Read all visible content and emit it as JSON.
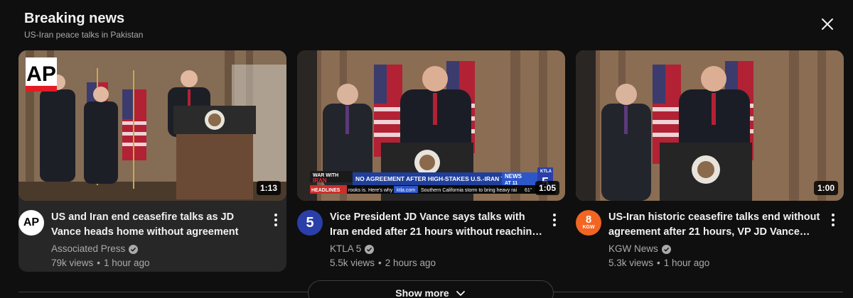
{
  "section": {
    "title": "Breaking news",
    "subtitle": "US-Iran peace talks in Pakistan"
  },
  "videos": [
    {
      "title": "US and Iran end ceasefire talks as JD Vance heads home without agreement",
      "channel": "Associated Press",
      "views": "79k views",
      "age": "1 hour ago",
      "duration": "1:13",
      "avatar_text": "AP",
      "avatar_color": "#ffffff",
      "logo_text": "AP"
    },
    {
      "title": "Vice President JD Vance says talks with Iran ended after 21 hours without reaching …",
      "channel": "KTLA 5",
      "views": "5.5k views",
      "age": "2 hours ago",
      "duration": "1:05",
      "avatar_text": "5",
      "avatar_color": "#2a3fa8",
      "ticker": {
        "tag_top": "WAR WITH",
        "tag_mid": "IRAN",
        "tag_bottom": "HEADLINES",
        "headline": "NO AGREEMENT AFTER HIGH-STAKES U.S.-IRAN TALKS",
        "news_label": "NEWS",
        "news_time": "AT 11",
        "crawl": "rooks is. Here's why",
        "site": "ktla.com",
        "crawl2": "Southern California storm to bring heavy rai",
        "temp": "61°",
        "station": "KTLA",
        "station_num": "5"
      }
    },
    {
      "title": "US-Iran historic ceasefire talks end without agreement after 21 hours, VP JD Vance says",
      "channel": "KGW News",
      "views": "5.3k views",
      "age": "1 hour ago",
      "duration": "1:00",
      "avatar_text": "8",
      "avatar_sub": "KGW",
      "avatar_color": "#f26522"
    }
  ],
  "show_more_label": "Show more",
  "icons": {
    "close": "close-icon",
    "kebab": "more-vert-icon",
    "verified": "verified-check-icon",
    "chevron": "chevron-down-icon"
  },
  "colors": {
    "background": "#0f0f0f",
    "card_hover": "#272727",
    "text_primary": "#f1f1f1",
    "text_secondary": "#aaaaaa"
  }
}
